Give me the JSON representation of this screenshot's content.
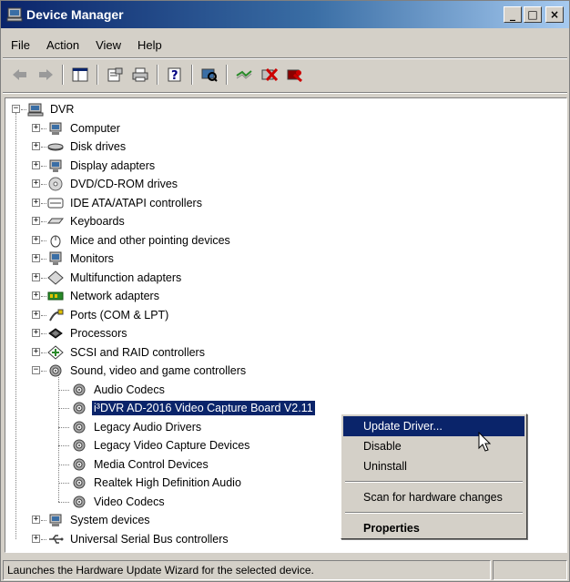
{
  "window": {
    "title": "Device Manager",
    "buttons": {
      "minimize": "_",
      "maximize": "□",
      "close": "×"
    }
  },
  "menu": [
    "File",
    "Action",
    "View",
    "Help"
  ],
  "toolbar": [
    "back-arrow-icon",
    "forward-arrow-icon",
    "show-hide-tree-icon",
    "properties-icon",
    "print-icon",
    "help-icon",
    "scan-hardware-icon",
    "update-driver-icon",
    "uninstall-icon",
    "disable-icon"
  ],
  "tree": {
    "root": "DVR",
    "categories": [
      "Computer",
      "Disk drives",
      "Display adapters",
      "DVD/CD-ROM drives",
      "IDE ATA/ATAPI controllers",
      "Keyboards",
      "Mice and other pointing devices",
      "Monitors",
      "Multifunction adapters",
      "Network adapters",
      "Ports (COM & LPT)",
      "Processors",
      "SCSI and RAID controllers",
      "Sound, video and game controllers"
    ],
    "sound_children": [
      "Audio Codecs",
      "i³DVR AD-2016 Video Capture Board V2.11",
      "Legacy Audio Drivers",
      "Legacy Video Capture Devices",
      "Media Control Devices",
      "Realtek High Definition Audio",
      "Video Codecs"
    ],
    "tail_categories": [
      "System devices",
      "Universal Serial Bus controllers"
    ]
  },
  "context_menu": {
    "update_driver": "Update Driver...",
    "disable": "Disable",
    "uninstall": "Uninstall",
    "scan": "Scan for hardware changes",
    "properties": "Properties"
  },
  "status": "Launches the Hardware Update Wizard for the selected device.",
  "colors": {
    "titlebar_start": "#0a246a",
    "selection": "#0a246a",
    "chrome": "#d4d0c8"
  }
}
